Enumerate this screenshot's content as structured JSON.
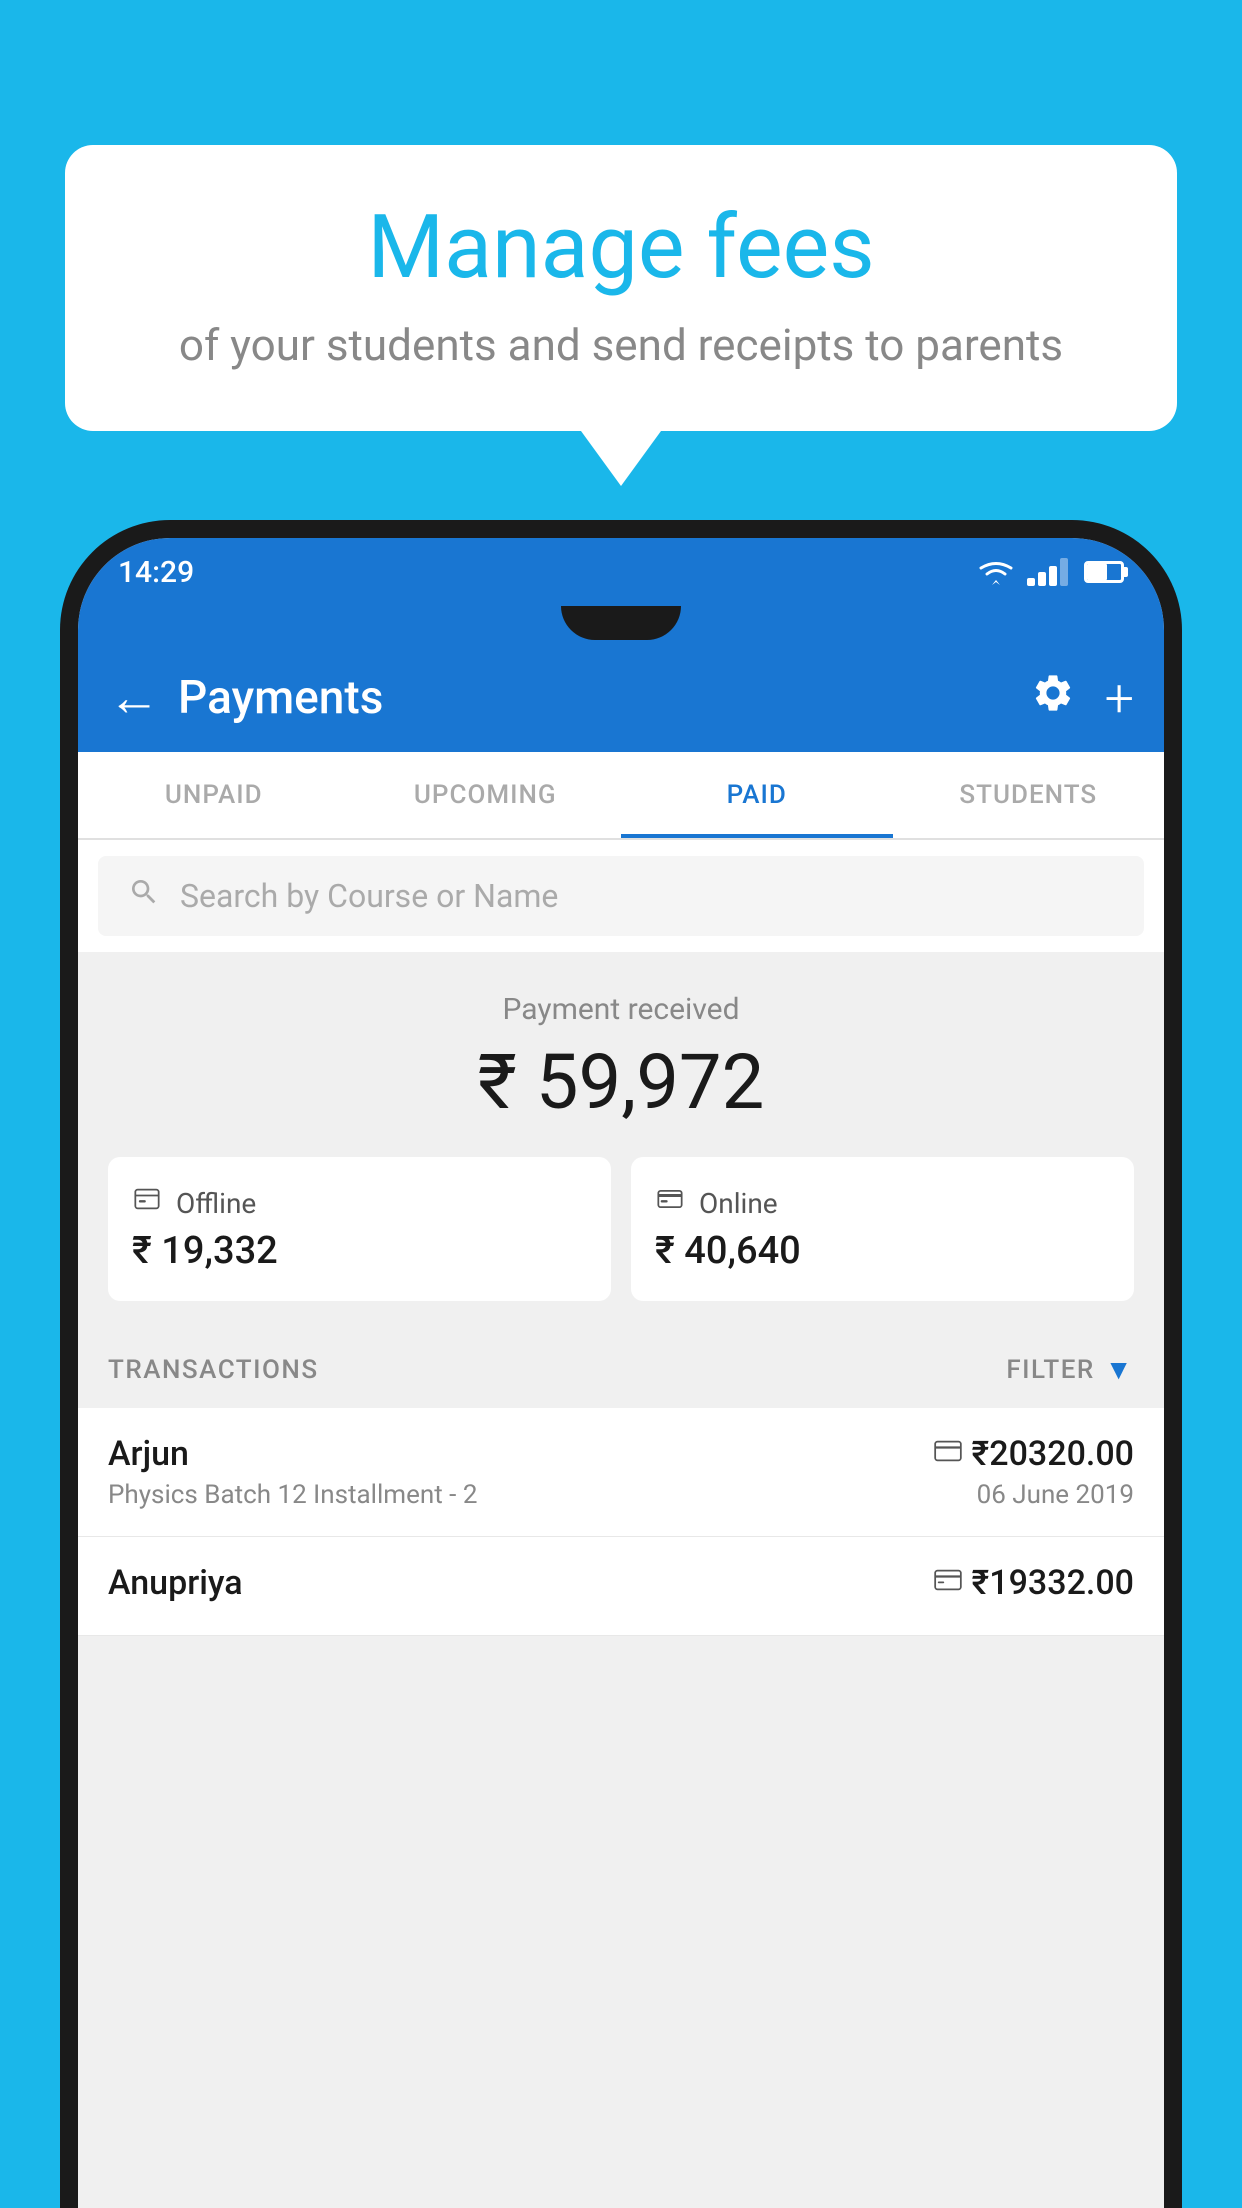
{
  "background_color": "#1ab7ea",
  "speech_bubble": {
    "title": "Manage fees",
    "subtitle": "of your students and send receipts to parents"
  },
  "status_bar": {
    "time": "14:29"
  },
  "app_bar": {
    "title": "Payments",
    "back_label": "←",
    "plus_label": "+"
  },
  "tabs": [
    {
      "label": "UNPAID",
      "active": false
    },
    {
      "label": "UPCOMING",
      "active": false
    },
    {
      "label": "PAID",
      "active": true
    },
    {
      "label": "STUDENTS",
      "active": false
    }
  ],
  "search": {
    "placeholder": "Search by Course or Name"
  },
  "payment_summary": {
    "received_label": "Payment received",
    "total_amount": "₹ 59,972",
    "offline": {
      "label": "Offline",
      "amount": "₹ 19,332"
    },
    "online": {
      "label": "Online",
      "amount": "₹ 40,640"
    }
  },
  "transactions": {
    "header_label": "TRANSACTIONS",
    "filter_label": "FILTER",
    "rows": [
      {
        "name": "Arjun",
        "course": "Physics Batch 12 Installment - 2",
        "amount": "₹20320.00",
        "date": "06 June 2019",
        "type": "online"
      },
      {
        "name": "Anupriya",
        "course": "",
        "amount": "₹19332.00",
        "date": "",
        "type": "offline"
      }
    ]
  }
}
